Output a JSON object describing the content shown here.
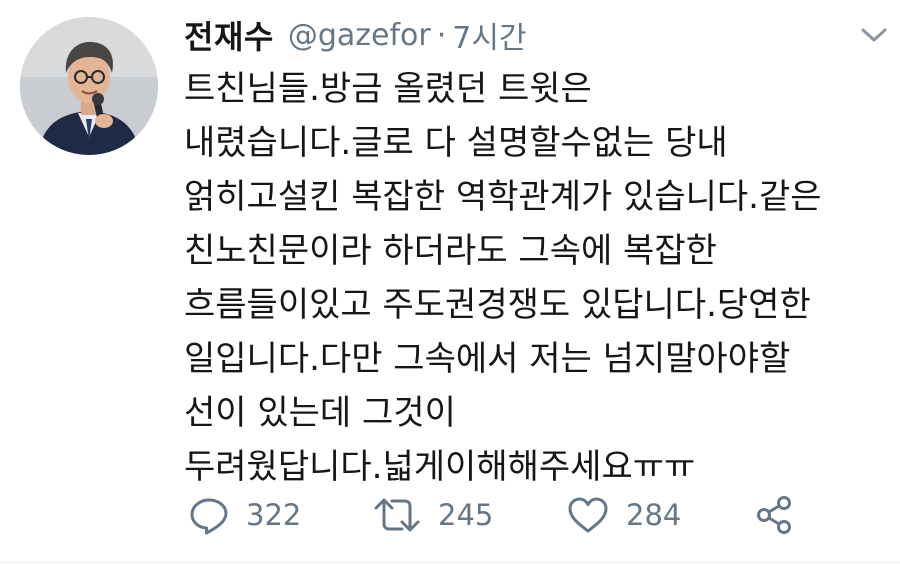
{
  "author": {
    "display_name": "전재수",
    "handle": "@gazefor",
    "separator": "·",
    "timestamp": "7시간",
    "avatar_icon": "profile-photo-man-with-microphone"
  },
  "tweet": {
    "lines": [
      "트친님들.방금 올렸던 트윗은",
      "내렸습니다.글로 다 설명할수없는 당내",
      "얽히고설킨 복잡한 역학관계가 있습니다.같은",
      "친노친문이라 하더라도 그속에 복잡한",
      "흐름들이있고 주도권경쟁도 있답니다.당연한",
      "일입니다.다만 그속에서 저는 넘지말아야할",
      "선이 있는데 그것이",
      "두려웠답니다.넓게이해해주세요ㅠㅠ"
    ]
  },
  "actions": {
    "reply": {
      "icon": "reply-icon",
      "count": "322"
    },
    "retweet": {
      "icon": "retweet-icon",
      "count": "245"
    },
    "like": {
      "icon": "heart-icon",
      "count": "284"
    },
    "share": {
      "icon": "share-icon"
    }
  },
  "menu": {
    "icon": "chevron-down-icon"
  },
  "colors": {
    "text_primary": "#14171a",
    "text_secondary": "#657786",
    "icon": "#657786",
    "background": "#ffffff"
  }
}
